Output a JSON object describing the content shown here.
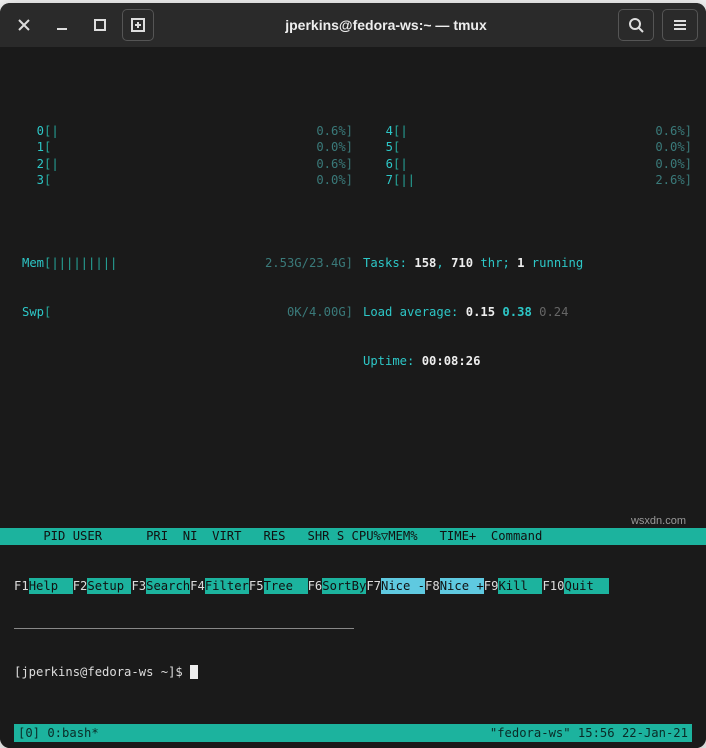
{
  "window": {
    "title": "jperkins@fedora-ws:~ — tmux"
  },
  "cpu_meters_left": [
    {
      "idx": "0",
      "bar": "[|",
      "bar_end": "0.6%]"
    },
    {
      "idx": "1",
      "bar": "[",
      "bar_end": "0.0%]"
    },
    {
      "idx": "2",
      "bar": "[|",
      "bar_end": "0.6%]"
    },
    {
      "idx": "3",
      "bar": "[",
      "bar_end": "0.0%]"
    }
  ],
  "cpu_meters_right": [
    {
      "idx": "4",
      "bar": "[|",
      "bar_end": "0.6%]"
    },
    {
      "idx": "5",
      "bar": "[",
      "bar_end": "0.0%]"
    },
    {
      "idx": "6",
      "bar": "[|",
      "bar_end": "0.0%]"
    },
    {
      "idx": "7",
      "bar": "[||",
      "bar_end": "2.6%]"
    }
  ],
  "mem": {
    "label": "Mem",
    "bar": "[|||||||||",
    "val": "2.53G/23.4G]"
  },
  "swp": {
    "label": "Swp",
    "bar": "[",
    "val": "0K/4.00G]"
  },
  "tasks": {
    "label": "Tasks: ",
    "procs": "158",
    "sep": ", ",
    "thr": "710",
    "thr_lbl": " thr; ",
    "running": "1",
    "running_lbl": " running"
  },
  "load": {
    "label": "Load average: ",
    "l1": "0.15",
    "l2": " 0.38 ",
    "l3": "0.24"
  },
  "uptime": {
    "label": "Uptime: ",
    "val": "00:08:26"
  },
  "headers": "    PID USER      PRI  NI  VIRT   RES   SHR S CPU%▽MEM%   TIME+  Command        ",
  "fkeys": [
    {
      "k": "F1",
      "l": "Help  "
    },
    {
      "k": "F2",
      "l": "Setup "
    },
    {
      "k": "F3",
      "l": "Search"
    },
    {
      "k": "F4",
      "l": "Filter"
    },
    {
      "k": "F5",
      "l": "Tree  "
    },
    {
      "k": "F6",
      "l": "SortBy"
    },
    {
      "k": "F7",
      "l": "Nice -"
    },
    {
      "k": "F8",
      "l": "Nice +"
    },
    {
      "k": "F9",
      "l": "Kill  "
    },
    {
      "k": "F10",
      "l": "Quit  "
    }
  ],
  "prompt": "[jperkins@fedora-ws ~]$ ",
  "status": {
    "left": "[0] 0:bash*",
    "right": "\"fedora-ws\" 15:56 22-Jan-21"
  },
  "watermark": "wsxdn.com"
}
